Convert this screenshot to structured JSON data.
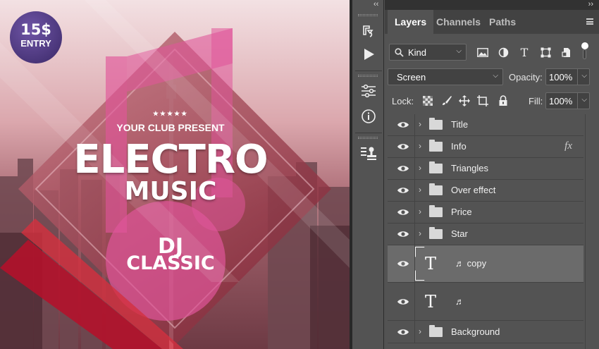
{
  "poster": {
    "badge_price": "15$",
    "badge_entry": "ENTRY",
    "stars": "★★★★★",
    "club_line": "YOUR CLUB PRESENT",
    "headline": "ELECTRO",
    "subheadline": "MUSIC",
    "dj_line": "DJ",
    "dj_name": "CLASSIC",
    "colors": {
      "pink": "#e0569a",
      "red": "#b3122b",
      "sky": "#d99aa3"
    }
  },
  "toolstrip": {
    "collapse": "‹‹",
    "tools": [
      "history-brush-icon",
      "play-icon",
      "adjustments-icon",
      "info-icon",
      "stamp-icon"
    ]
  },
  "panel": {
    "collapse": "››",
    "tabs": [
      "Layers",
      "Channels",
      "Paths"
    ],
    "filter_kind": "Kind",
    "blend_mode": "Screen",
    "opacity_label": "Opacity:",
    "opacity_value": "100%",
    "lock_label": "Lock:",
    "fill_label": "Fill:",
    "fill_value": "100%",
    "layers": [
      {
        "name": "Title",
        "type": "group"
      },
      {
        "name": "Info",
        "type": "group",
        "fx": "fx"
      },
      {
        "name": "Triangles",
        "type": "group"
      },
      {
        "name": "Over effect",
        "type": "group"
      },
      {
        "name": "Price",
        "type": "group"
      },
      {
        "name": "Star",
        "type": "group"
      },
      {
        "name": "♬ copy",
        "type": "text",
        "thumb": "T",
        "selected": true
      },
      {
        "name": "♬",
        "type": "text",
        "thumb": "T"
      },
      {
        "name": "Background",
        "type": "group"
      }
    ]
  }
}
